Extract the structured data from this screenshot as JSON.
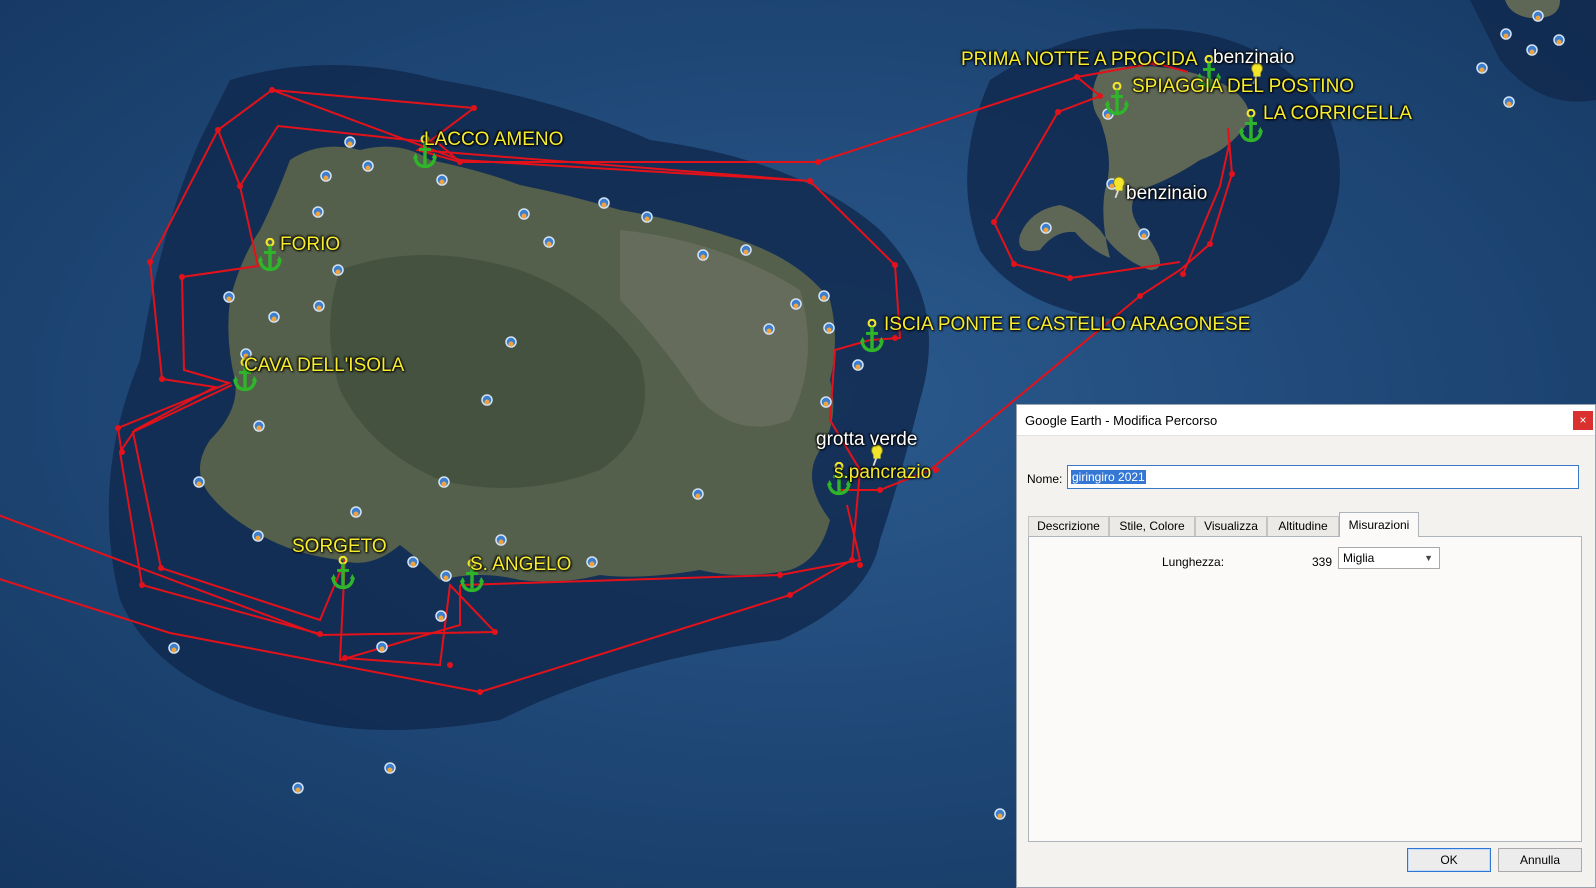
{
  "map": {
    "labels": {
      "prima_notte": "PRIMA NOTTE A PROCIDA",
      "benzinaio_top": "benzinaio",
      "spiaggia_postino": "SPIAGGIA DEL POSTINO",
      "corricella": "LA CORRICELLA",
      "benzinaio_mid": "benzinaio",
      "lacco_ameno": "LACCO AMENO",
      "forio": "FORIO",
      "iscia_ponte": "ISCIA PONTE E CASTELLO ARAGONESE",
      "cava_isola": "CAVA DELL'ISOLA",
      "grotta_verde": "grotta verde",
      "s_pancrazio": "s.pancrazio",
      "sorgeto": "SORGETO",
      "s_angelo": "S. ANGELO"
    },
    "colors": {
      "route": "#e3121a",
      "label_yellow": "#f7ec2e",
      "anchor": "#2fb52a",
      "pin": "#f2e52a"
    }
  },
  "dialog": {
    "title": "Google Earth - Modifica Percorso",
    "close": "×",
    "name_label": "Nome:",
    "name_value": "giringiro 2021",
    "tabs": [
      "Descrizione",
      "Stile, Colore",
      "Visualizza",
      "Altitudine",
      "Misurazioni"
    ],
    "active_tab": "Misurazioni",
    "length_label": "Lunghezza:",
    "length_value": "339",
    "unit": "Miglia",
    "ok": "OK",
    "cancel": "Annulla"
  }
}
